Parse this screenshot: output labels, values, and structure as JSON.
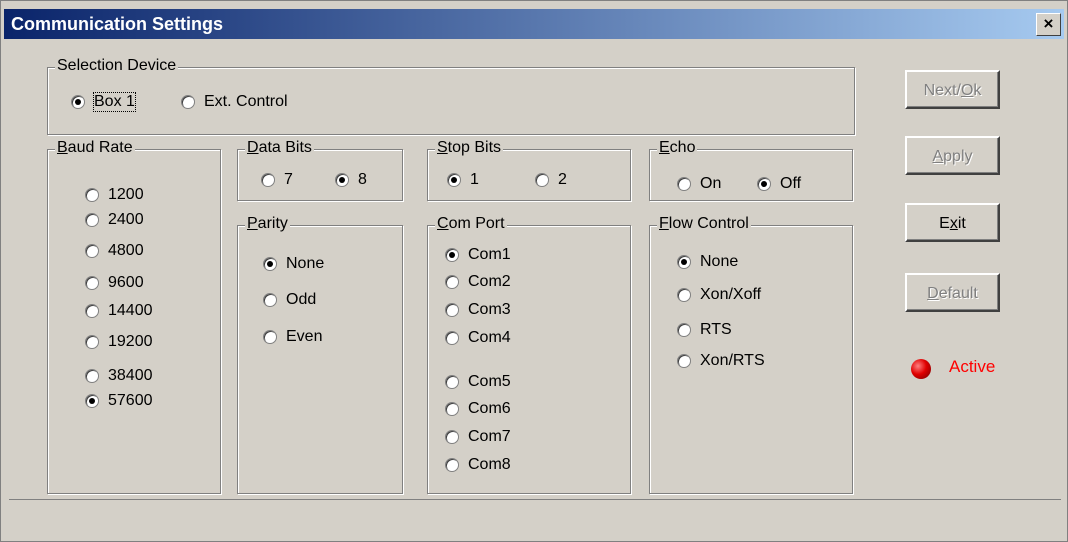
{
  "window": {
    "title": "Communication Settings",
    "close_label": "×"
  },
  "selection_device": {
    "title": "Selection Device",
    "options": [
      {
        "label": "Box 1",
        "checked": true
      },
      {
        "label": "Ext. Control",
        "checked": false
      }
    ]
  },
  "baud_rate": {
    "title_accel": "B",
    "title_rest": "aud Rate",
    "options": [
      {
        "label": "1200",
        "checked": false
      },
      {
        "label": "2400",
        "checked": false
      },
      {
        "label": "4800",
        "checked": false
      },
      {
        "label": "9600",
        "checked": false
      },
      {
        "label": "14400",
        "checked": false
      },
      {
        "label": "19200",
        "checked": false
      },
      {
        "label": "38400",
        "checked": false
      },
      {
        "label": "57600",
        "checked": true
      }
    ]
  },
  "data_bits": {
    "title_accel": "D",
    "title_rest": "ata Bits",
    "options": [
      {
        "label": "7",
        "checked": false
      },
      {
        "label": "8",
        "checked": true
      }
    ]
  },
  "stop_bits": {
    "title_accel": "S",
    "title_rest": "top Bits",
    "options": [
      {
        "label": "1",
        "checked": true
      },
      {
        "label": "2",
        "checked": false
      }
    ]
  },
  "echo": {
    "title_accel": "E",
    "title_rest": "cho",
    "options": [
      {
        "label": "On",
        "checked": false
      },
      {
        "label": "Off",
        "checked": true
      }
    ]
  },
  "parity": {
    "title_accel": "P",
    "title_rest": "arity",
    "options": [
      {
        "label": "None",
        "checked": true
      },
      {
        "label": "Odd",
        "checked": false
      },
      {
        "label": "Even",
        "checked": false
      }
    ]
  },
  "com_port": {
    "title_accel": "C",
    "title_rest": "om Port",
    "options": [
      {
        "label": "Com1",
        "checked": true
      },
      {
        "label": "Com2",
        "checked": false
      },
      {
        "label": "Com3",
        "checked": false
      },
      {
        "label": "Com4",
        "checked": false
      },
      {
        "label": "Com5",
        "checked": false
      },
      {
        "label": "Com6",
        "checked": false
      },
      {
        "label": "Com7",
        "checked": false
      },
      {
        "label": "Com8",
        "checked": false
      }
    ]
  },
  "flow_control": {
    "title_accel": "F",
    "title_rest": "low Control",
    "options": [
      {
        "label": "None",
        "checked": true
      },
      {
        "label": "Xon/Xoff",
        "checked": false
      },
      {
        "label": "RTS",
        "checked": false
      },
      {
        "label": "Xon/RTS",
        "checked": false
      }
    ]
  },
  "buttons": {
    "next": {
      "pre": "Next/",
      "accel": "O",
      "post": "k",
      "enabled": false
    },
    "apply": {
      "pre": "",
      "accel": "A",
      "post": "pply",
      "enabled": false
    },
    "exit": {
      "pre": "E",
      "accel": "x",
      "post": "it",
      "enabled": true
    },
    "default": {
      "pre": "",
      "accel": "D",
      "post": "efault",
      "enabled": false
    }
  },
  "status": {
    "label": "Active",
    "led_color": "#e00000"
  },
  "colors": {
    "face": "#d4d0c8",
    "title_start": "#0a246a",
    "title_end": "#a6caf0",
    "active": "#ff0000"
  }
}
